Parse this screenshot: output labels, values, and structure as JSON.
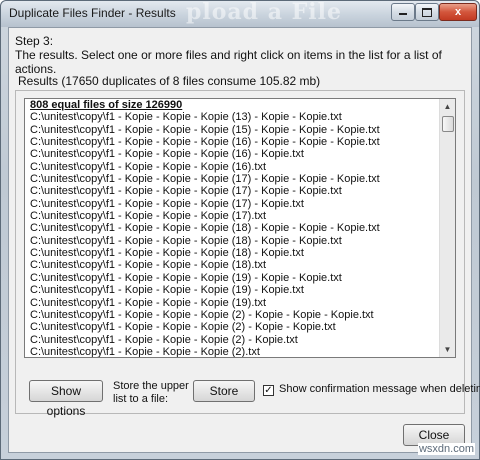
{
  "window": {
    "title": "Duplicate Files Finder - Results",
    "ghost_text": "pload a File",
    "controls": {
      "minimize": "–",
      "maximize": "□",
      "close": "x"
    }
  },
  "step": {
    "title": "Step 3:",
    "description": "The results. Select one or more files and right click on items in the list for a list of actions."
  },
  "results": {
    "legend": "Results (17650 duplicates of 8 files consume 105.82 mb)",
    "header": "808 equal files of size 126990",
    "rows": [
      "C:\\unitest\\copy\\f1 - Kopie - Kopie - Kopie (13) - Kopie - Kopie.txt",
      "C:\\unitest\\copy\\f1 - Kopie - Kopie - Kopie (15) - Kopie - Kopie - Kopie.txt",
      "C:\\unitest\\copy\\f1 - Kopie - Kopie - Kopie (16) - Kopie - Kopie - Kopie.txt",
      "C:\\unitest\\copy\\f1 - Kopie - Kopie - Kopie (16) - Kopie.txt",
      "C:\\unitest\\copy\\f1 - Kopie - Kopie - Kopie (16).txt",
      "C:\\unitest\\copy\\f1 - Kopie - Kopie - Kopie (17) - Kopie - Kopie - Kopie.txt",
      "C:\\unitest\\copy\\f1 - Kopie - Kopie - Kopie (17) - Kopie - Kopie.txt",
      "C:\\unitest\\copy\\f1 - Kopie - Kopie - Kopie (17) - Kopie.txt",
      "C:\\unitest\\copy\\f1 - Kopie - Kopie - Kopie (17).txt",
      "C:\\unitest\\copy\\f1 - Kopie - Kopie - Kopie (18) - Kopie - Kopie - Kopie.txt",
      "C:\\unitest\\copy\\f1 - Kopie - Kopie - Kopie (18) - Kopie - Kopie.txt",
      "C:\\unitest\\copy\\f1 - Kopie - Kopie - Kopie (18) - Kopie.txt",
      "C:\\unitest\\copy\\f1 - Kopie - Kopie - Kopie (18).txt",
      "C:\\unitest\\copy\\f1 - Kopie - Kopie - Kopie (19) - Kopie - Kopie.txt",
      "C:\\unitest\\copy\\f1 - Kopie - Kopie - Kopie (19) - Kopie.txt",
      "C:\\unitest\\copy\\f1 - Kopie - Kopie - Kopie (19).txt",
      "C:\\unitest\\copy\\f1 - Kopie - Kopie - Kopie (2) - Kopie - Kopie - Kopie.txt",
      "C:\\unitest\\copy\\f1 - Kopie - Kopie - Kopie (2) - Kopie - Kopie.txt",
      "C:\\unitest\\copy\\f1 - Kopie - Kopie - Kopie (2) - Kopie.txt",
      "C:\\unitest\\copy\\f1 - Kopie - Kopie - Kopie (2).txt"
    ]
  },
  "actions": {
    "show_options": "Show options",
    "store_label": "Store the upper list to a file:",
    "store": "Store",
    "confirm_checked": true,
    "confirm_label": "Show confirmation message when deleting",
    "close": "Close"
  },
  "watermark": "wsxdn.com",
  "icons": {
    "check": "✓",
    "scroll_up": "▲",
    "scroll_down": "▼"
  }
}
